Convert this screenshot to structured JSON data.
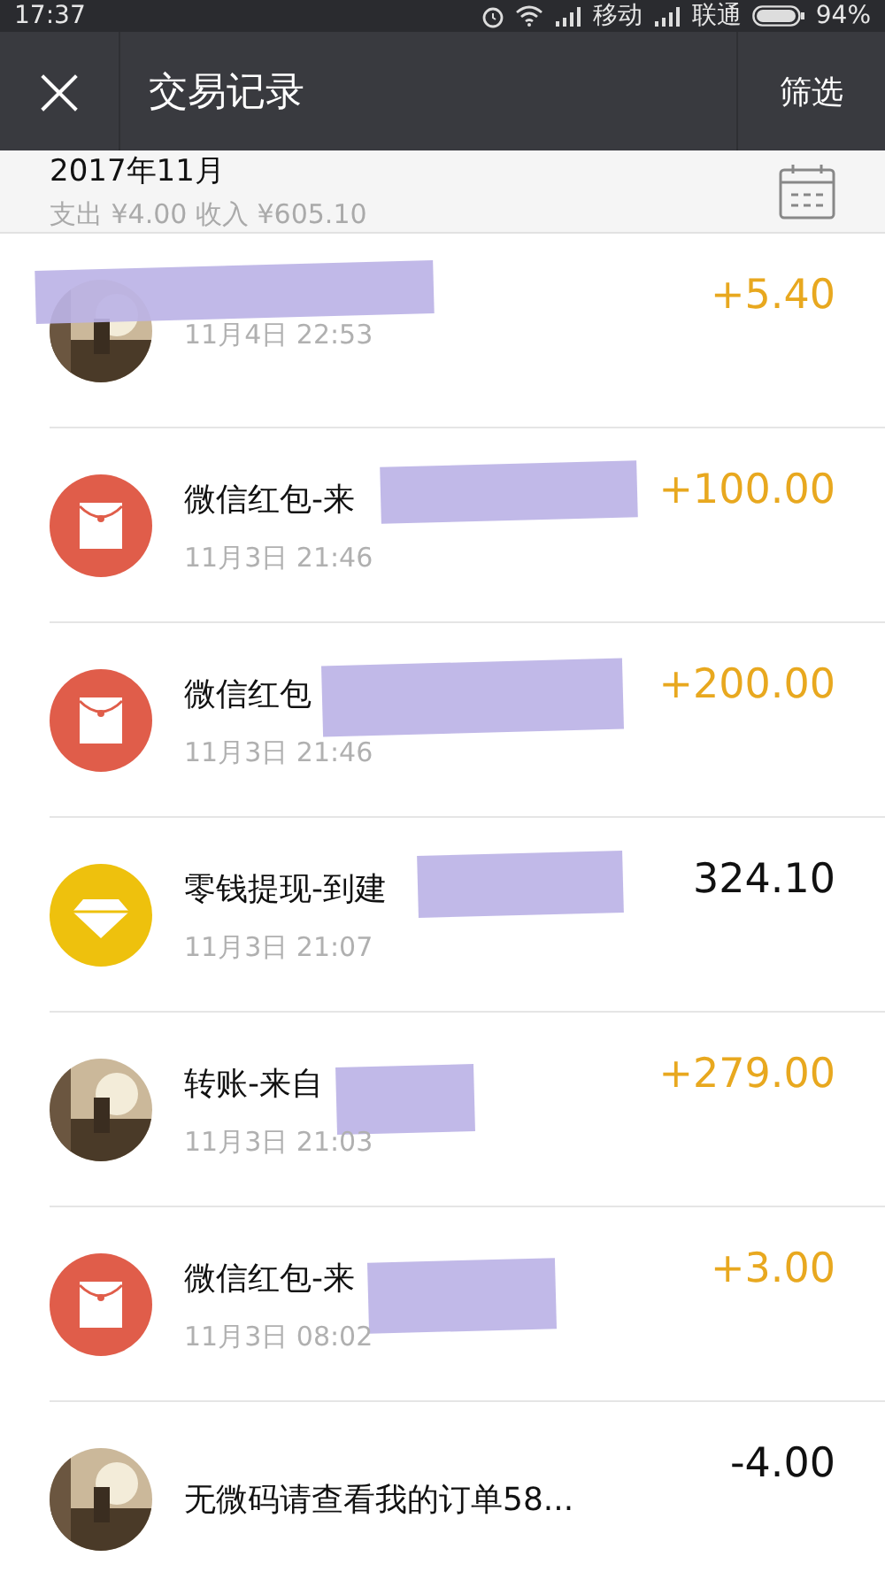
{
  "status_bar": {
    "time": "17:37",
    "carrier_1": "移动",
    "carrier_2": "联通",
    "battery": "94%"
  },
  "title_bar": {
    "close": "×",
    "title": "交易记录",
    "action": "筛选"
  },
  "summary": {
    "month": "2017年11月",
    "totals": "支出 ¥4.00 收入 ¥605.10"
  },
  "transactions": [
    {
      "time": "11月4日 22:53",
      "amount": "+5.40",
      "income": true,
      "redacted": true
    },
    {
      "kind": "red-packet",
      "title": "微信红包-来",
      "time": "11月3日 21:46",
      "amount": "+100.00",
      "income": true,
      "redacted": true
    },
    {
      "kind": "red-packet",
      "title": "微信红包",
      "time": "11月3日 21:46",
      "amount": "+200.00",
      "income": true,
      "redacted": true
    },
    {
      "kind": "diamond",
      "title": "零钱提现-到建",
      "time": "11月3日 21:07",
      "amount": "324.10",
      "income": false,
      "redacted": true
    },
    {
      "title": "转账-来自",
      "time": "11月3日 21:03",
      "amount": "+279.00",
      "income": true,
      "redacted": true
    },
    {
      "kind": "red-packet",
      "title": "微信红包-来",
      "time": "11月3日 08:02",
      "amount": "+3.00",
      "income": true,
      "redacted": true
    },
    {
      "title": "无微码请查看我的订单58...",
      "amount": "-4.00",
      "income": false
    }
  ]
}
